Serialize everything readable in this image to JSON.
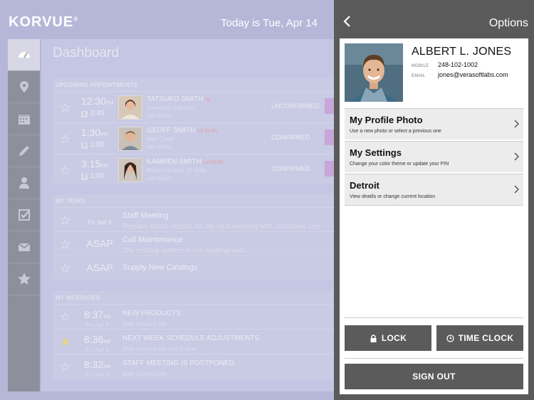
{
  "header": {
    "logo": "KORVUE",
    "logo_mark": "®",
    "today": "Today is Tue, Apr 14"
  },
  "sidebar": {
    "items": [
      {
        "icon": "dashboard-icon"
      },
      {
        "icon": "location-pin-icon"
      },
      {
        "icon": "calendar-icon"
      },
      {
        "icon": "pencil-icon"
      },
      {
        "icon": "person-icon"
      },
      {
        "icon": "checkbox-icon"
      },
      {
        "icon": "envelope-icon"
      },
      {
        "icon": "star-icon"
      }
    ]
  },
  "dashboard": {
    "title": "Dashboard",
    "appointments": {
      "label": "UPCOMING APPOINTMENTS",
      "items": [
        {
          "time": "12:30",
          "ampm": "PM",
          "num": "1",
          "duration": "0:45",
          "name": "TATSUKO SMITH",
          "tag": "St",
          "service": "Juvederm Injection",
          "with": "with Alber",
          "status": "UNCONFIRMED"
        },
        {
          "time": "1:30",
          "ampm": "PM",
          "num": "3",
          "duration": "1:00",
          "name": "GEOFF SMITH",
          "tag": "Lo Sv Pv",
          "service": "Wax Chest",
          "with": "with Alber",
          "status": "CONFIRMED"
        },
        {
          "time": "3:15",
          "ampm": "PM",
          "num": "2",
          "duration": "1:00",
          "name": "KAMREN SMITH",
          "tag": "Lo Sv Pv",
          "service": "Botox Injection 10 Units",
          "with": "with Alber",
          "status": "CONFIRMED"
        }
      ]
    },
    "tasks": {
      "label": "MY TASKS",
      "items": [
        {
          "date": "Fri, Apr 3",
          "title": "Staff Meeting",
          "sub": "Prepare status reports for the next meeting with Josephine Lee"
        },
        {
          "date": "ASAP",
          "title": "Call Maintenance",
          "sub": "The cooling system is not working well."
        },
        {
          "date": "ASAP",
          "title": "Supply New Catalogs",
          "sub": ""
        }
      ]
    },
    "messages": {
      "label": "MY MESSAGES",
      "items": [
        {
          "time": "8:37",
          "ampm": "AM",
          "date": "Fri, Apr 3",
          "title": "NEW PRODUCTS",
          "sub": "Bree Jones to Me",
          "starred": false
        },
        {
          "time": "8:36",
          "ampm": "AM",
          "date": "Fri, Apr 3",
          "title": "NEXT WEEK SCHEDULE ADJUSTMENTS",
          "sub": "Bree Jones to Me and 1 other",
          "starred": true
        },
        {
          "time": "8:32",
          "ampm": "AM",
          "date": "Fri, Apr 3",
          "title": "STAFF MEETING IS POSTPONED",
          "sub": "Bree Jones to Me",
          "starred": false
        }
      ]
    }
  },
  "options": {
    "back_icon": "chevron-left-icon",
    "title": "Options",
    "profile": {
      "name": "ALBERT L. JONES",
      "mobile_label": "MOBILE",
      "mobile": "248-102-1002",
      "email_label": "EMAIL",
      "email": "jones@verasoftlabs.com"
    },
    "menu": [
      {
        "title": "My Profile Photo",
        "sub": "Use a new photo or select a previous one"
      },
      {
        "title": "My Settings",
        "sub": "Change your color theme or update your PIN"
      },
      {
        "title": "Detroit",
        "sub": "View deatils or change current location"
      }
    ],
    "lock_label": "LOCK",
    "timeclock_label": "TIME CLOCK",
    "signout_label": "SIGN OUT"
  }
}
